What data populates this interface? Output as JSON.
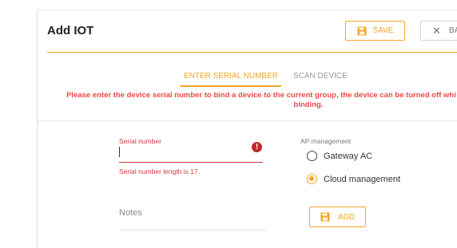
{
  "header": {
    "title": "Add IOT",
    "save_label": "SAVE",
    "back_label": "BA"
  },
  "tabs": [
    {
      "label": "ENTER SERIAL NUMBER",
      "active": true
    },
    {
      "label": "SCAN DEVICE",
      "active": false
    }
  ],
  "notice": {
    "line1": "Please enter the device serial number to bind a device to the current group, the device can be turned off whi",
    "line2": "binding."
  },
  "form": {
    "serial_label": "Serial number",
    "serial_value": "",
    "serial_error": "Serial number length is 17.",
    "notes_label": "Notes",
    "ap_label": "AP management",
    "ap_options": [
      {
        "label": "Gateway AC",
        "selected": false
      },
      {
        "label": "Cloud management",
        "selected": true
      }
    ],
    "add_label": "ADD"
  },
  "colors": {
    "accent": "#f5a623",
    "error": "#d0393f",
    "notice": "#f04848"
  },
  "icons": {
    "save": "floppy-disk-icon",
    "back": "close-icon",
    "error": "exclamation-circle-icon",
    "add": "floppy-disk-icon"
  }
}
